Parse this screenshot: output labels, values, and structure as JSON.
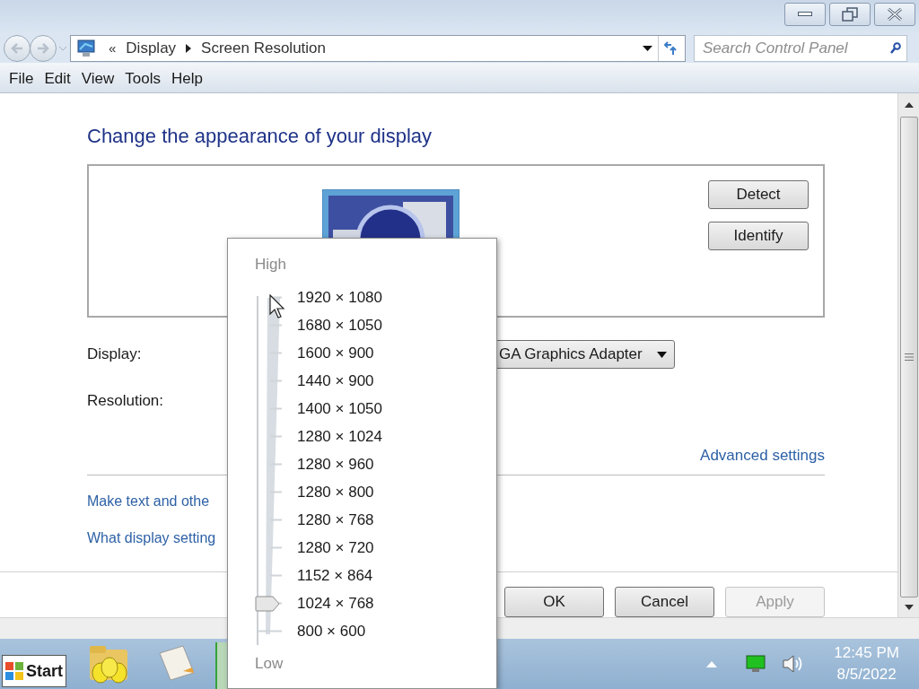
{
  "address_bar": {
    "overflow": "«",
    "breadcrumbs": [
      "Display",
      "Screen Resolution"
    ]
  },
  "search": {
    "placeholder": "Search Control Panel"
  },
  "menu": [
    "File",
    "Edit",
    "View",
    "Tools",
    "Help"
  ],
  "heading": "Change the appearance of your display",
  "monitor_buttons": [
    "Detect",
    "Identify"
  ],
  "display": {
    "label": "Display:",
    "value": "GA Graphics Adapter"
  },
  "resolution": {
    "label": "Resolution:"
  },
  "advanced_link": "Advanced settings",
  "links": [
    "Make text and othe",
    "What display setting"
  ],
  "buttons": [
    {
      "label": "OK",
      "disabled": false
    },
    {
      "label": "Cancel",
      "disabled": false
    },
    {
      "label": "Apply",
      "disabled": true
    }
  ],
  "resolution_popup": {
    "high_label": "High",
    "low_label": "Low",
    "level": 0.0833,
    "options": [
      "1920 × 1080",
      "1680 × 1050",
      "1600 × 900",
      "1440 × 900",
      "1400 × 1050",
      "1280 × 1024",
      "1280 × 960",
      "1280 × 800",
      "1280 × 768",
      "1280 × 720",
      "1152 × 864",
      "1024 × 768",
      "800 × 600"
    ]
  },
  "taskbar": {
    "start": "Start",
    "time": "12:45 PM",
    "date": "8/5/2022"
  }
}
